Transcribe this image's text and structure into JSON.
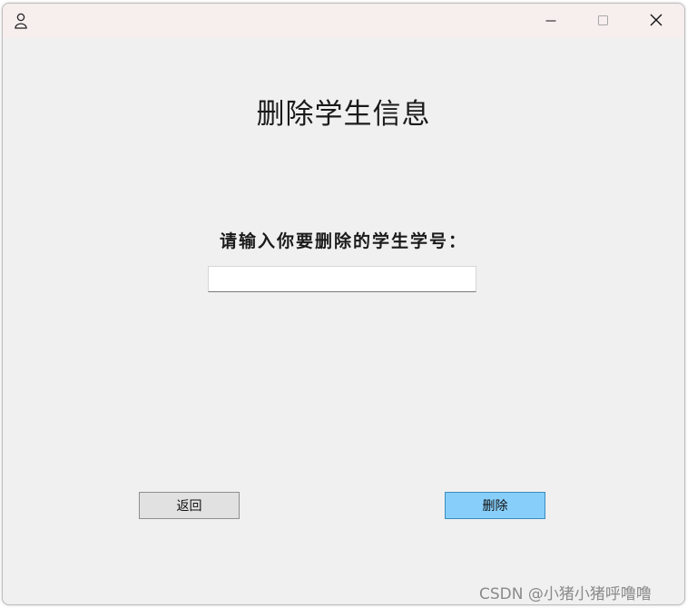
{
  "window": {
    "app_icon": "user-icon",
    "controls": {
      "minimize_icon": "minimize-icon",
      "maximize_icon": "maximize-icon",
      "close_icon": "close-icon"
    }
  },
  "content": {
    "heading": "删除学生信息",
    "prompt": "请输入你要删除的学生学号：",
    "student_id_input": {
      "value": "",
      "placeholder": ""
    },
    "back_button_label": "返回",
    "delete_button_label": "删除"
  },
  "watermark": "CSDN @小猪小猪呼噜噜",
  "colors": {
    "window_background": "#f0f0f0",
    "titlebar_background": "#f7eeee",
    "delete_button": "#87cefa",
    "back_button": "#e1e1e1"
  }
}
